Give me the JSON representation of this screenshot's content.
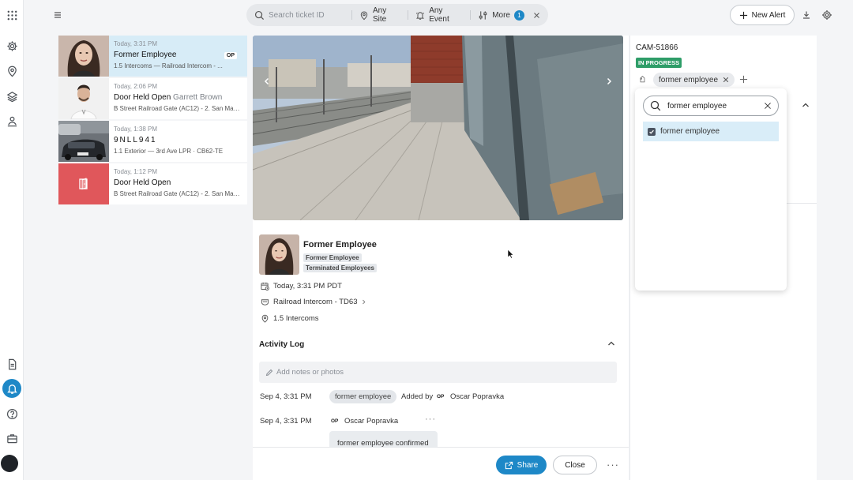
{
  "topbar": {
    "search_placeholder": "Search ticket ID",
    "filters": [
      {
        "label": "Any Site",
        "icon": "location-pin-icon"
      },
      {
        "label": "Any Event",
        "icon": "bell-icon"
      },
      {
        "label": "More",
        "icon": "sliders-icon",
        "count": "1"
      }
    ],
    "new_alert_label": "New Alert"
  },
  "alerts": [
    {
      "time": "Today, 3:31 PM",
      "title": "Former Employee",
      "subtitle": "",
      "desc": "1.5 Intercoms — Railroad Intercom - ...",
      "op": "OP",
      "active": true
    },
    {
      "time": "Today, 2:06 PM",
      "title": "Door Held Open",
      "subtitle": "Garrett Brown",
      "desc": "B Street Railroad Gate (AC12) - 2. San Mat...",
      "active": false
    },
    {
      "time": "Today, 1:38 PM",
      "title": "9NLL941",
      "subtitle": "",
      "desc": "1.1 Exterior — 3rd Ave LPR · CB62-TE",
      "active": false
    },
    {
      "time": "Today, 1:12 PM",
      "title": "Door Held Open",
      "subtitle": "",
      "desc": "B Street Railroad Gate (AC12) - 2. San Mat...",
      "active": false
    }
  ],
  "detail": {
    "person_name": "Former Employee",
    "tags": [
      "Former Employee",
      "Terminated Employees"
    ],
    "time": "Today, 3:31 PM PDT",
    "device": "Railroad Intercom - TD63",
    "location": "1.5 Intercoms",
    "activity_heading": "Activity Log",
    "notes_placeholder": "Add notes or photos",
    "log": [
      {
        "time": "Sep 4, 3:31 PM",
        "chip": "former employee",
        "action": "Added by",
        "op": "OP",
        "user": "Oscar Popravka"
      },
      {
        "time": "Sep 4, 3:31 PM",
        "op": "OP",
        "user": "Oscar Popravka",
        "comment": "former employee confirmed"
      }
    ]
  },
  "footer": {
    "share_label": "Share",
    "close_label": "Close"
  },
  "panel": {
    "camera_id": "CAM-51866",
    "status": "IN PROGRESS",
    "tag_chip": "former employee",
    "dropdown_search_value": "former employee",
    "dropdown_option": "former employee",
    "dropdown_option_checked": true
  },
  "colors": {
    "accent": "#1e88c7",
    "status_green": "#2e9d68",
    "active_row": "#d7ecf7",
    "door_alert": "#e0575b"
  }
}
